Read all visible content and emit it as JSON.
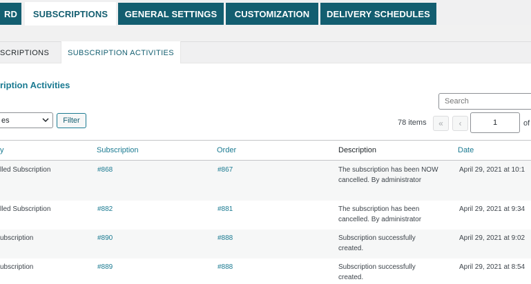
{
  "top_tabs": [
    {
      "label": "RD"
    },
    {
      "label": "SUBSCRIPTIONS"
    },
    {
      "label": "GENERAL SETTINGS"
    },
    {
      "label": "CUSTOMIZATION"
    },
    {
      "label": "DELIVERY SCHEDULES"
    }
  ],
  "sub_tabs": [
    {
      "label": "SCRIPTIONS"
    },
    {
      "label": "SUBSCRIPTION ACTIVITIES"
    }
  ],
  "heading": "ription Activities",
  "search": {
    "placeholder": "Search"
  },
  "filter": {
    "select_value": "es",
    "button_label": "Filter"
  },
  "pagination": {
    "count": "78 items",
    "first": "«",
    "prev": "‹",
    "current_page": "1",
    "of": "of"
  },
  "table": {
    "headers": [
      "y",
      "Subscription",
      "Order",
      "Description",
      "Date"
    ],
    "rows": [
      {
        "activity": "lled Subscription",
        "subscription": "#868",
        "order": "#867",
        "description": "The subscription has been NOW cancelled. By administrator",
        "date": "April 29, 2021 at 10:1"
      },
      {
        "activity": "lled Subscription",
        "subscription": "#882",
        "order": "#881",
        "description": "The subscription has been cancelled. By administrator",
        "date": "April 29, 2021 at 9:34"
      },
      {
        "activity": "ubscription",
        "subscription": "#890",
        "order": "#888",
        "description": "Subscription successfully created.",
        "date": "April 29, 2021 at 9:02"
      },
      {
        "activity": "ubscription",
        "subscription": "#889",
        "order": "#888",
        "description": "Subscription successfully created.",
        "date": "April 29, 2021 at 8:54"
      }
    ]
  }
}
